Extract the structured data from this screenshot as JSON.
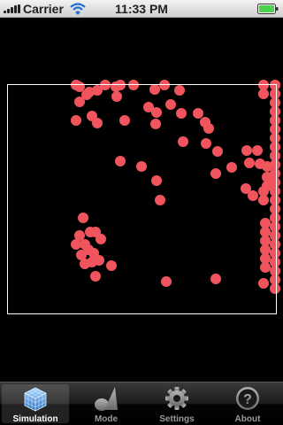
{
  "status_bar": {
    "carrier": "Carrier",
    "time": "11:33 PM",
    "signal_icon": "signal-bars-icon",
    "wifi_icon": "wifi-icon",
    "battery_icon": "battery-icon"
  },
  "simulation": {
    "particle_color": "#f0555e",
    "box_color": "#ffffff"
  },
  "tab_bar": {
    "selected": "simulation",
    "tabs": [
      {
        "id": "simulation",
        "label": "Simulation",
        "icon": "cube-grid-icon"
      },
      {
        "id": "mode",
        "label": "Mode",
        "icon": "shape-pair-icon"
      },
      {
        "id": "settings",
        "label": "Settings",
        "icon": "gear-icon"
      },
      {
        "id": "about",
        "label": "About",
        "icon": "question-icon"
      }
    ]
  }
}
